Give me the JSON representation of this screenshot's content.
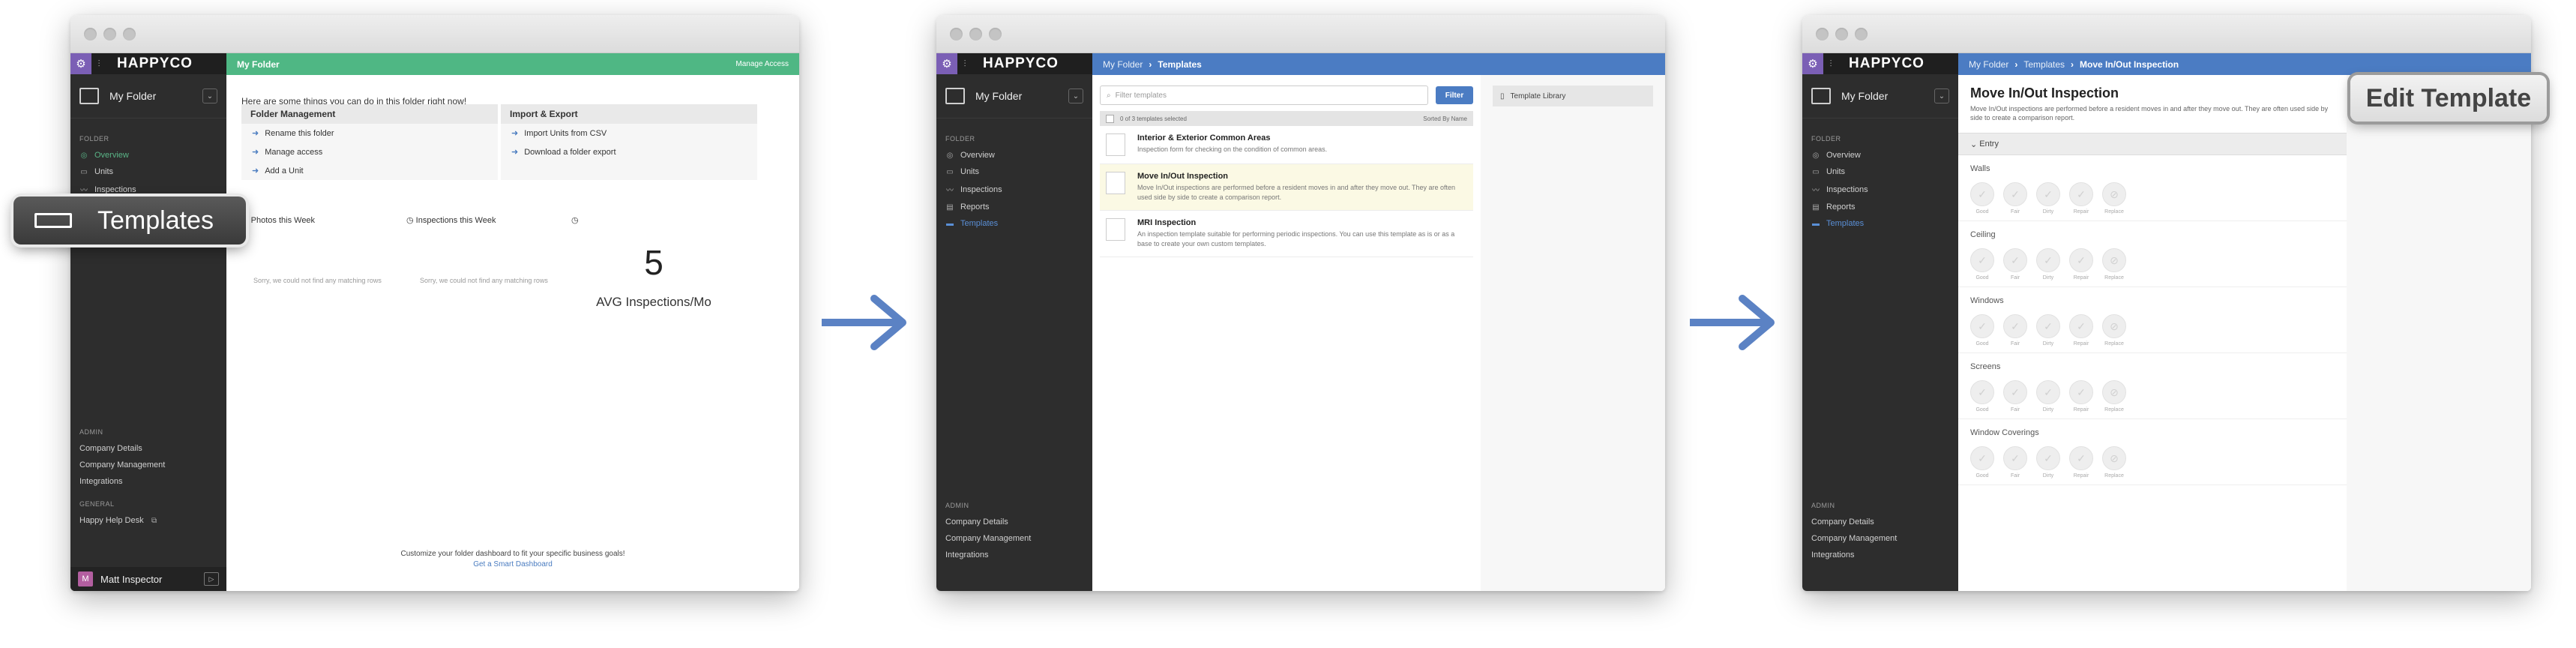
{
  "brand": {
    "name": "HAPPYCO"
  },
  "folder": {
    "name": "My Folder"
  },
  "nav": {
    "folder_section": "FOLDER",
    "items": [
      {
        "label": "Overview",
        "icon": "overview-icon"
      },
      {
        "label": "Units",
        "icon": "units-icon"
      },
      {
        "label": "Inspections",
        "icon": "inspections-icon"
      },
      {
        "label": "Reports",
        "icon": "reports-icon"
      },
      {
        "label": "Templates",
        "icon": "templates-icon"
      }
    ],
    "admin_section": "ADMIN",
    "admin_items": [
      "Company Details",
      "Company Management",
      "Integrations"
    ],
    "general_section": "GENERAL",
    "general_items": [
      "Happy Help Desk"
    ]
  },
  "user": {
    "name": "Matt Inspector",
    "initial": "M"
  },
  "screen1": {
    "header_title": "My Folder",
    "manage_access": "Manage Access",
    "intro": "Here are some things you can do in this folder right now!",
    "folder_mgmt": {
      "title": "Folder Management",
      "items": [
        "Rename this folder",
        "Manage access",
        "Add a Unit"
      ]
    },
    "import_export": {
      "title": "Import & Export",
      "items": [
        "Import Units from CSV",
        "Download a folder export"
      ]
    },
    "photos_label": "Photos this Week",
    "inspections_label": "Inspections this Week",
    "empty_note": "Sorry, we could not find any matching rows",
    "avg_value": "5",
    "avg_label": "AVG Inspections/Mo",
    "customize_note": "Customize your folder dashboard to fit your specific business goals!",
    "customize_link": "Get a Smart Dashboard"
  },
  "callout_templates": "Templates",
  "screen2": {
    "crumb_root": "My Folder",
    "crumb_current": "Templates",
    "search_placeholder": "Filter templates",
    "filter_button": "Filter",
    "selected_text": "0 of 3 templates selected",
    "sort_text": "Sorted By Name",
    "templates": [
      {
        "title": "Interior & Exterior Common Areas",
        "desc": "Inspection form for checking on the condition of common areas."
      },
      {
        "title": "Move In/Out Inspection",
        "desc": "Move In/Out inspections are performed before a resident moves in and after they move out. They are often used side by side to create a comparison report."
      },
      {
        "title": "MRI Inspection",
        "desc": "An inspection template suitable for performing periodic inspections. You can use this template as is or as a base to create your own custom templates."
      }
    ],
    "library_label": "Template Library"
  },
  "screen3": {
    "crumb_root": "My Folder",
    "crumb_mid": "Templates",
    "crumb_current": "Move In/Out Inspection",
    "title": "Move In/Out Inspection",
    "desc": "Move In/Out inspections are performed before a resident moves in and after they move out. They are often used side by side to create a comparison report.",
    "entry_label": "Entry",
    "sections": [
      "Walls",
      "Ceiling",
      "Windows",
      "Screens",
      "Window Coverings"
    ],
    "options": [
      "Good",
      "Fair",
      "Dirty",
      "Repair",
      "Replace"
    ]
  },
  "callout_edit": "Edit Template",
  "colors": {
    "green": "#4fb784",
    "blue": "#4b7cc3",
    "sidebar": "#2d2d2d",
    "accent_arrow": "#5b82c4"
  }
}
